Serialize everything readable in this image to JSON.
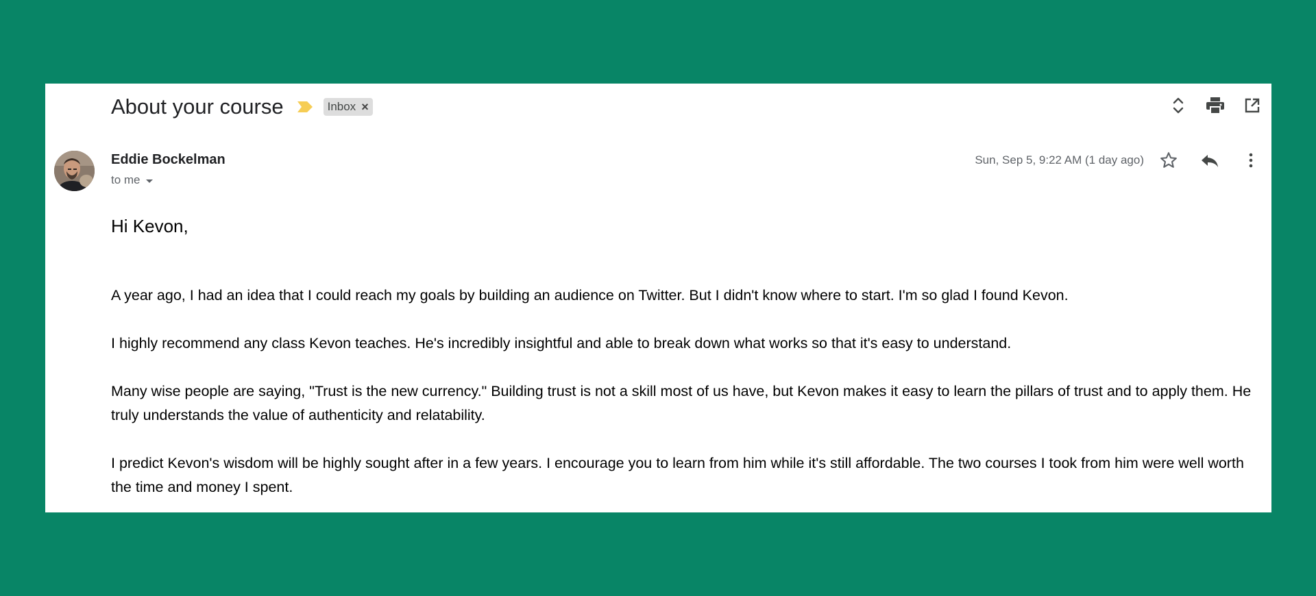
{
  "email": {
    "subject": "About your course",
    "label": "Inbox",
    "label_remove": "×",
    "sender": "Eddie Bockelman",
    "recipient": "to me",
    "date": "Sun, Sep 5, 9:22 AM (1 day ago)",
    "greeting": "Hi Kevon,",
    "paragraphs": [
      "A year ago, I had an idea that I could reach my goals by building an audience on Twitter.  But I didn't know where to start.  I'm so glad I found Kevon.",
      "I highly recommend any class Kevon teaches.  He's incredibly insightful and able to break down what works so that it's easy to understand.",
      "Many wise people are saying, \"Trust is the new currency.\" Building trust is not a skill most of us have, but Kevon makes it easy to learn the pillars of trust and to apply them. He truly understands the value of authenticity and relatability.",
      "I predict Kevon's wisdom will be highly sought after in a few years.  I encourage you to learn from him while it's still affordable.  The two courses I took from him were well worth the time and money I spent."
    ]
  },
  "icons": {
    "importance": "importance-marker-icon",
    "expand": "expand-all-icon",
    "print": "print-icon",
    "open_new": "open-in-new-window-icon",
    "star": "star-icon",
    "reply": "reply-icon",
    "more": "more-vertical-icon"
  },
  "colors": {
    "background": "#088566",
    "importance": "#f6cd55",
    "label_chip": "#dddddd",
    "icon": "#444746"
  }
}
